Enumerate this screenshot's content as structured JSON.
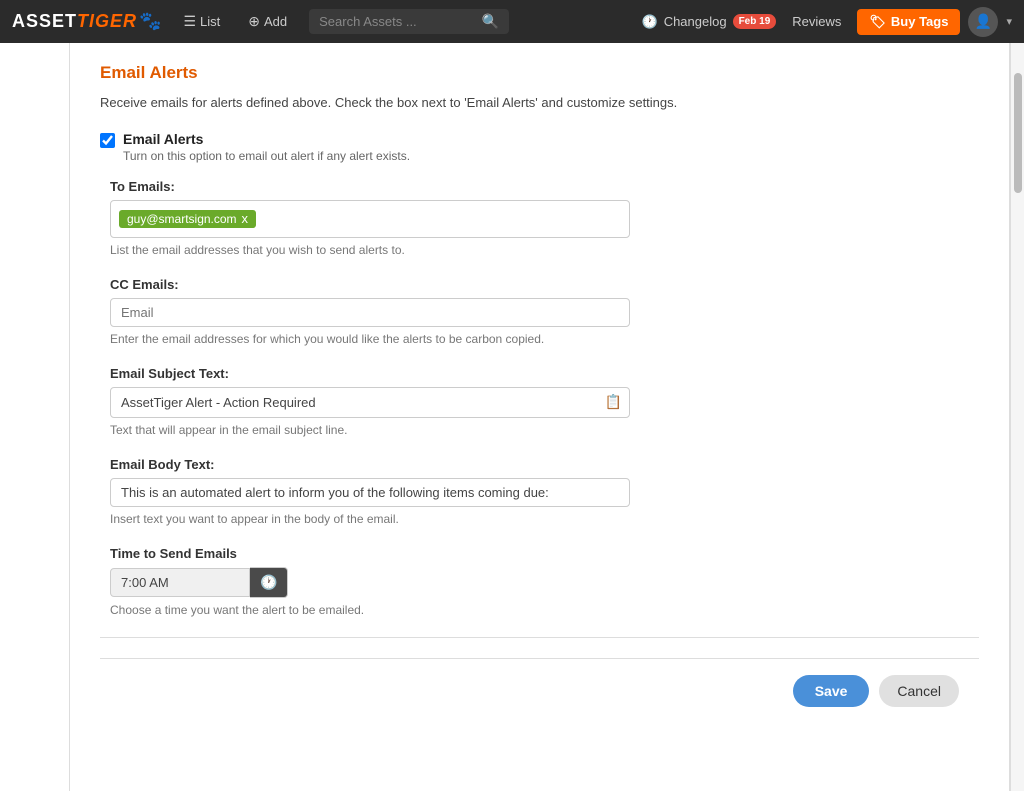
{
  "navbar": {
    "logo_asset": "ASSET",
    "logo_tiger": "TIGER",
    "nav_list": "List",
    "nav_add": "Add",
    "search_placeholder": "Search Assets ...",
    "changelog_label": "Changelog",
    "badge_text": "Feb 19",
    "reviews_label": "Reviews",
    "buy_tags_label": "Buy Tags"
  },
  "section": {
    "title": "Email Alerts",
    "description": "Receive emails for alerts defined above. Check the box next to 'Email Alerts' and customize settings.",
    "checkbox_label": "Email Alerts",
    "checkbox_sublabel": "Turn on this option to email out alert if any alert exists.",
    "to_emails_label": "To Emails:",
    "email_tag": "guy@smartsign.com",
    "to_emails_hint": "List the email addresses that you wish to send alerts to.",
    "cc_emails_label": "CC Emails:",
    "cc_emails_placeholder": "Email",
    "cc_emails_hint": "Enter the email addresses for which you would like the alerts to be carbon copied.",
    "subject_label": "Email Subject Text:",
    "subject_value": "AssetTiger Alert - Action Required",
    "subject_hint": "Text that will appear in the email subject line.",
    "body_label": "Email Body Text:",
    "body_value": "This is an automated alert to inform you of the following items coming due:",
    "body_hint": "Insert text you want to appear in the body of the email.",
    "time_label": "Time to Send Emails",
    "time_value": "7:00 AM",
    "time_hint": "Choose a time you want the alert to be emailed."
  },
  "buttons": {
    "save_label": "Save",
    "cancel_label": "Cancel"
  }
}
